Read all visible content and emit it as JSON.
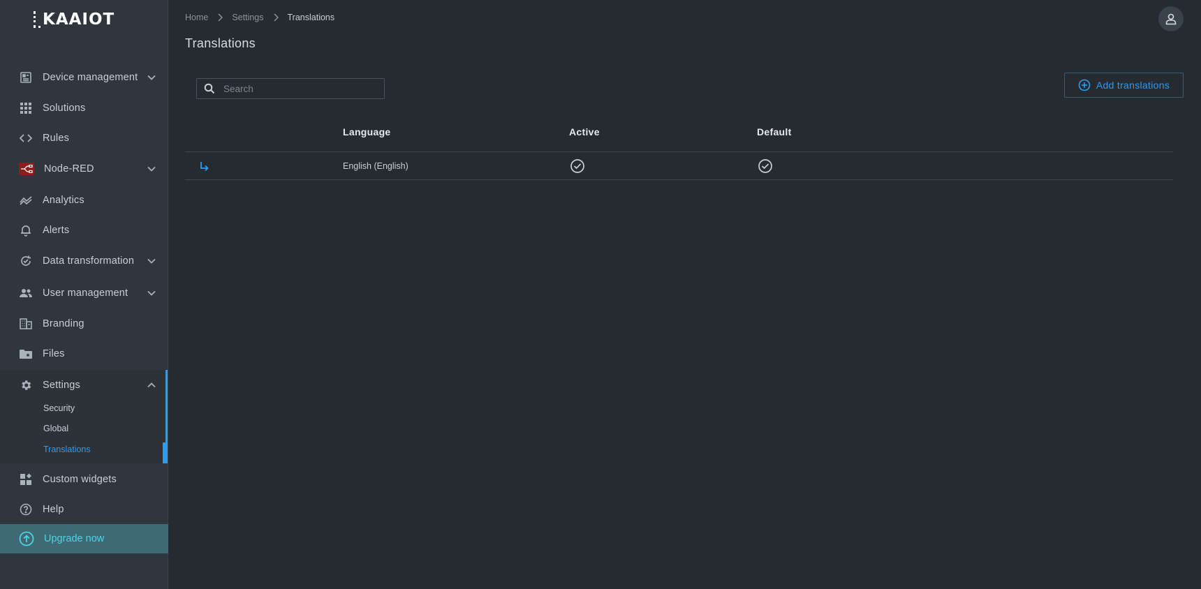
{
  "app": {
    "logo_text": "KAAIOT"
  },
  "sidebar": {
    "items": [
      {
        "label": "Device management",
        "icon": "device-management-icon",
        "has_chevron": true
      },
      {
        "label": "Solutions",
        "icon": "grid-icon"
      },
      {
        "label": "Rules",
        "icon": "code-icon"
      },
      {
        "label": "Node-RED",
        "icon": "node-red-icon",
        "has_chevron": true
      },
      {
        "label": "Analytics",
        "icon": "analytics-icon"
      },
      {
        "label": "Alerts",
        "icon": "bell-icon"
      },
      {
        "label": "Data transformation",
        "icon": "data-transformation-icon",
        "has_chevron": true
      },
      {
        "label": "User management",
        "icon": "users-icon",
        "has_chevron": true
      },
      {
        "label": "Branding",
        "icon": "building-icon"
      },
      {
        "label": "Files",
        "icon": "folder-icon"
      },
      {
        "label": "Settings",
        "icon": "gear-icon",
        "expanded": true
      },
      {
        "label": "Custom widgets",
        "icon": "widgets-icon"
      },
      {
        "label": "Help",
        "icon": "help-icon"
      }
    ],
    "settings_sub": [
      {
        "label": "Security"
      },
      {
        "label": "Global"
      },
      {
        "label": "Translations",
        "active": true
      }
    ],
    "upgrade_label": "Upgrade now"
  },
  "breadcrumb": [
    "Home",
    "Settings",
    "Translations"
  ],
  "page_title": "Translations",
  "search": {
    "placeholder": "Search",
    "value": ""
  },
  "add_button_label": "Add translations",
  "table": {
    "columns": [
      "Language",
      "Active",
      "Default"
    ],
    "rows": [
      {
        "language": "English (English)",
        "active": true,
        "default": true
      }
    ]
  },
  "colors": {
    "accent": "#2d9cf0",
    "sidebar_bg": "#2f363d",
    "main_bg": "#262b31",
    "upgrade_bg": "#3e6a73"
  }
}
